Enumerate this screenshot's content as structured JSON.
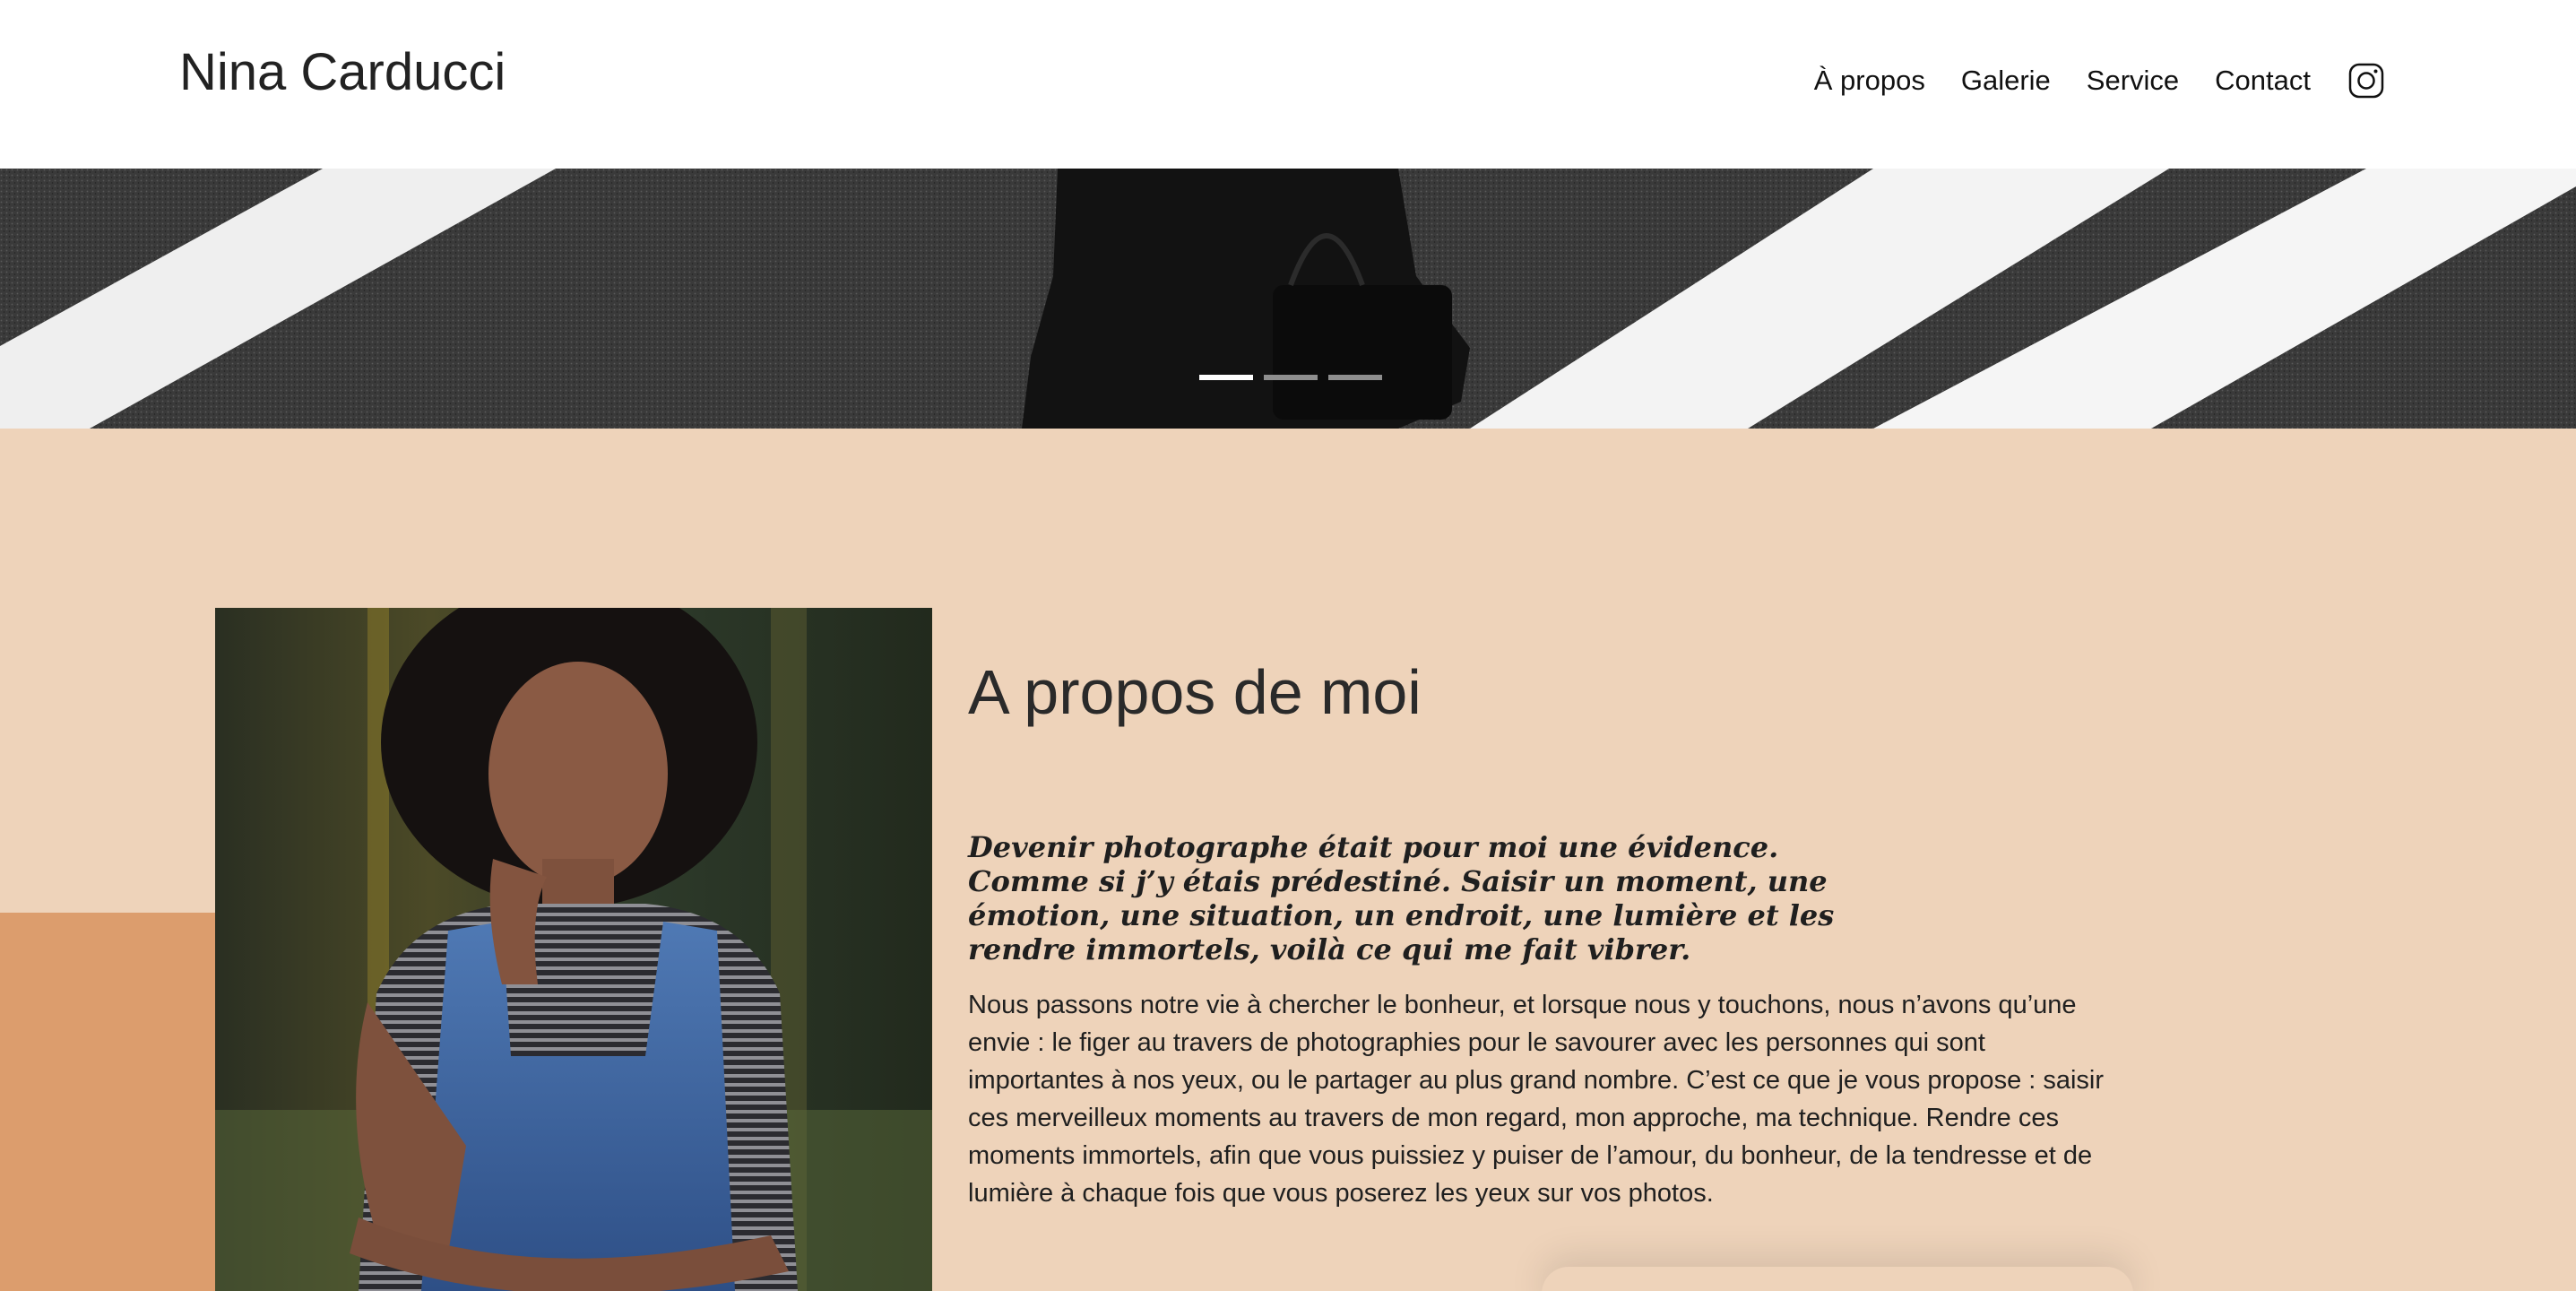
{
  "header": {
    "brand": "Nina Carducci",
    "nav": [
      {
        "label": "À propos"
      },
      {
        "label": "Galerie"
      },
      {
        "label": "Service"
      },
      {
        "label": "Contact"
      }
    ],
    "social_icon": "instagram-icon"
  },
  "hero": {
    "slides_count": 3,
    "active_slide": 1
  },
  "about": {
    "title": "A propos de moi",
    "quote": "Devenir photographe était pour moi une évidence. Comme si j’y étais prédestiné. Saisir un moment, une émotion, une situation, un endroit, une lumière et les rendre immortels, voilà ce qui me fait vibrer.",
    "text": "Nous passons notre vie à chercher le bonheur, et lorsque nous y touchons, nous n’avons qu’une envie : le figer au travers de photographies pour le savourer avec les personnes qui sont importantes à nos yeux, ou le partager au plus grand nombre. C’est ce que je vous propose : saisir ces merveilleux moments au travers de mon regard, mon approche, ma technique. Rendre ces moments immortels, afin que vous puissiez y puiser de l’amour, du bonheur, de la tendresse et de lumière à chaque fois que vous poserez les yeux sur vos photos."
  },
  "colors": {
    "section_bg": "#eed3ba",
    "accent": "#dc9d6d",
    "text": "#1f1f1f"
  }
}
